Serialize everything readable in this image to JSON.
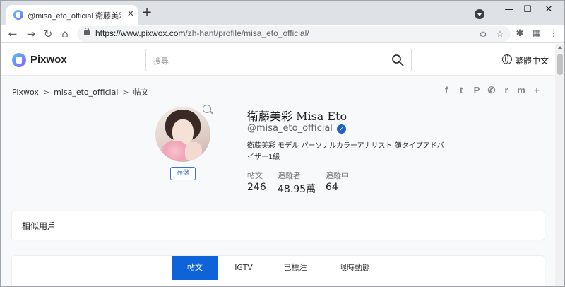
{
  "browser": {
    "tab_title": "@misa_eto_official 衛藤美彩 IG",
    "tab_close": "×",
    "new_tab": "+",
    "url_host": "https://www.pixwox.com",
    "url_path": "/zh-hant/profile/misa_eto_official/",
    "window_controls": {
      "minimize": "—",
      "maximize": "☐",
      "close": "✕"
    }
  },
  "site": {
    "brand": "Pixwox",
    "search_placeholder": "搜尋",
    "language": "繁體中文"
  },
  "breadcrumb": [
    "Pixwox",
    "misa_eto_official",
    "帖文"
  ],
  "breadcrumb_sep": ">",
  "share_icons": [
    "f",
    "t",
    "P",
    "✆",
    "r",
    "m",
    "+"
  ],
  "profile": {
    "name": "衛藤美彩 Misa Eto",
    "username": "@misa_eto_official",
    "verified_mark": "✓",
    "bio": "衛藤美彩 モデル パーソナルカラーアナリスト 顔タイプアドバイザー1級",
    "save_label": "存儲",
    "stats": [
      {
        "label": "帖文",
        "value": "246"
      },
      {
        "label": "追蹤者",
        "value": "48.95萬"
      },
      {
        "label": "追蹤中",
        "value": "64"
      }
    ]
  },
  "similar_users_label": "相似用戶",
  "content_tabs": [
    "帖文",
    "IGTV",
    "已標注",
    "限時動態"
  ],
  "colors": {
    "accent": "#0e63d8",
    "verified": "#1c62c9",
    "save_button": "#3b6fd3"
  }
}
